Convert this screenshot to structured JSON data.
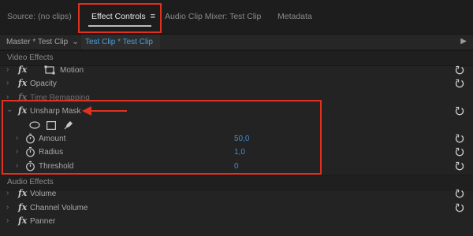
{
  "tabs": [
    {
      "label": "Source: (no clips)"
    },
    {
      "label": "Effect Controls"
    },
    {
      "label": "Audio Clip Mixer: Test Clip"
    },
    {
      "label": "Metadata"
    }
  ],
  "clip_bar": {
    "master_label": "Master * Test Clip",
    "sequence_label": "Test Clip * Test Clip"
  },
  "video_effects": {
    "section_label": "Video Effects",
    "motion": "Motion",
    "opacity": "Opacity",
    "time_remapping": "Time Remapping",
    "unsharp_mask": {
      "name": "Unsharp Mask",
      "params": [
        {
          "label": "Amount",
          "value": "50,0"
        },
        {
          "label": "Radius",
          "value": "1,0"
        },
        {
          "label": "Threshold",
          "value": "0"
        }
      ]
    }
  },
  "audio_effects": {
    "section_label": "Audio Effects",
    "volume": "Volume",
    "channel_volume": "Channel Volume",
    "panner": "Panner"
  },
  "icons": {
    "fx": "fx",
    "menu": "≡",
    "chevron_right": "›",
    "chevron_down": "⌄",
    "play": "▶"
  },
  "colors": {
    "highlight_box": "#e03020",
    "value_blue": "#3d8fd4",
    "sequence_blue": "#4a9fe0"
  }
}
